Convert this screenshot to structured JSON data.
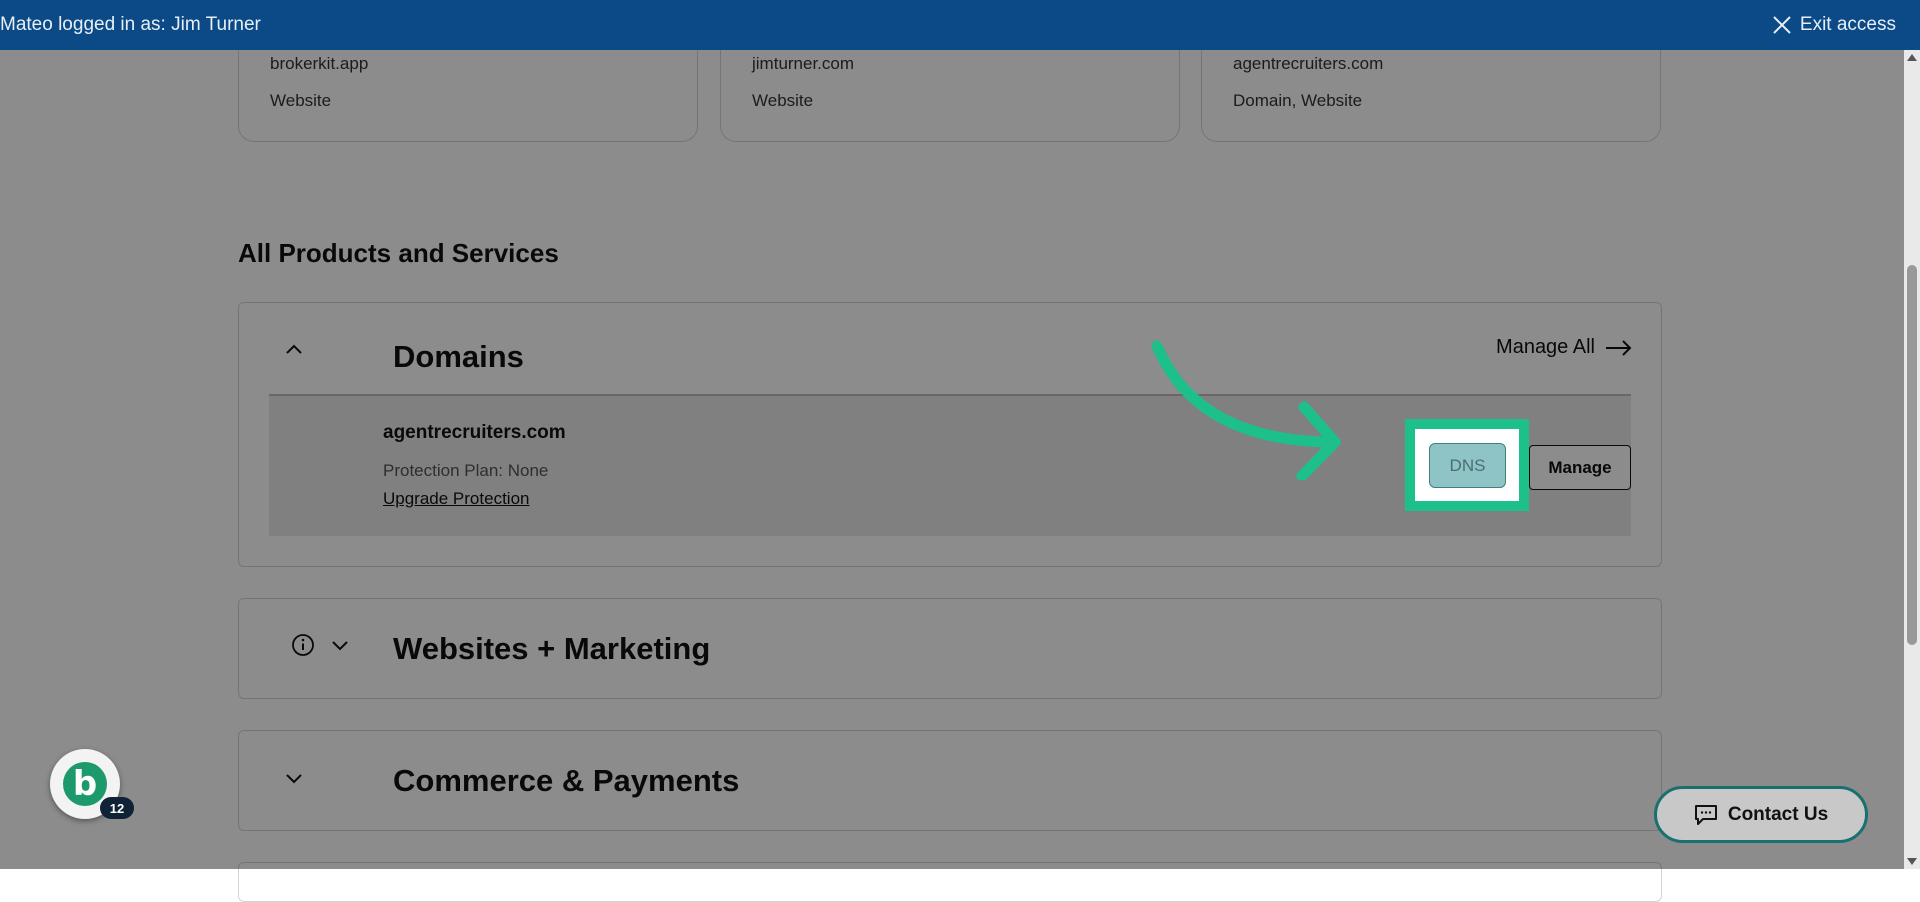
{
  "topbar": {
    "login_text": "Mateo logged in as: Jim Turner",
    "exit_label": "Exit access"
  },
  "cards": [
    {
      "domain": "brokerkit.app",
      "type": "Website"
    },
    {
      "domain": "jimturner.com",
      "type": "Website"
    },
    {
      "domain": "agentrecruiters.com",
      "type": "Domain, Website"
    }
  ],
  "section": {
    "title": "All Products and Services"
  },
  "domains_panel": {
    "title": "Domains",
    "manage_all_label": "Manage All",
    "row": {
      "name": "agentrecruiters.com",
      "protection": "Protection Plan: None",
      "upgrade_link": "Upgrade Protection",
      "dns_label": "DNS",
      "manage_label": "Manage"
    }
  },
  "websites_panel": {
    "title": "Websites + Marketing"
  },
  "commerce_panel": {
    "title": "Commerce & Payments"
  },
  "widgets": {
    "bubble_letter": "b",
    "bubble_count": "12",
    "contact_label": "Contact Us"
  },
  "colors": {
    "banner": "#0b4a86",
    "highlight": "#1dbf8b",
    "dns_button": "#8fc4c6",
    "contact_border": "#1a6f6f"
  }
}
